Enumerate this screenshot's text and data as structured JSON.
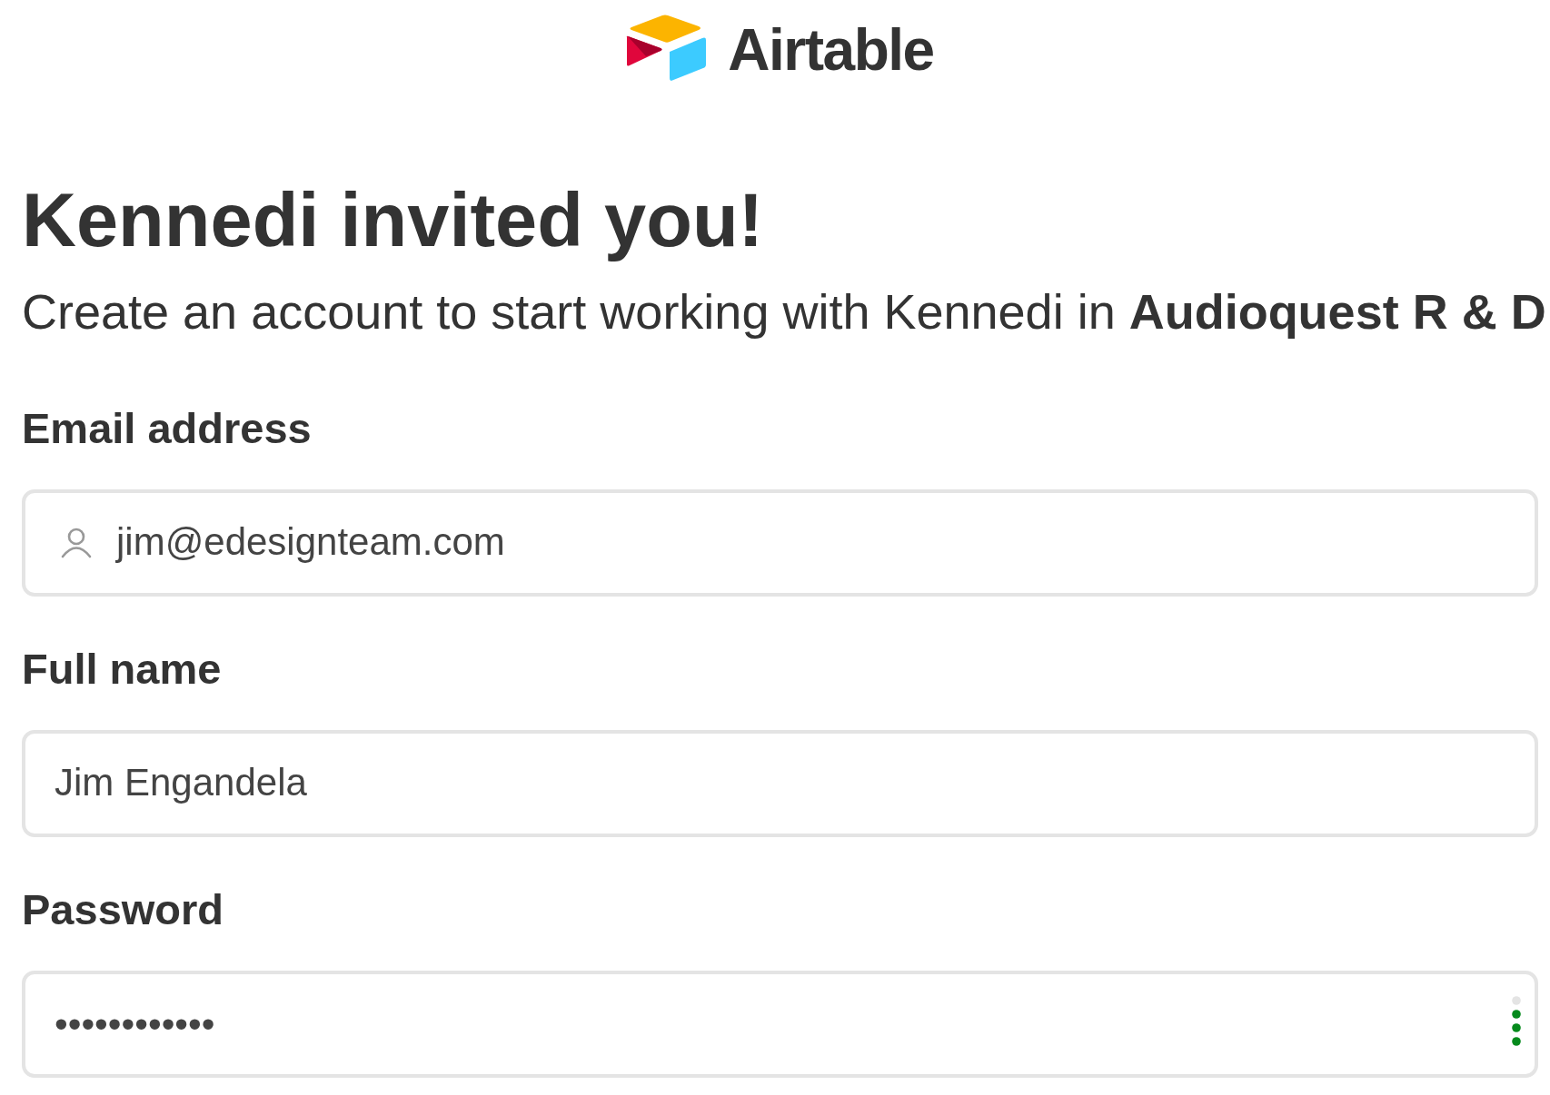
{
  "logo": {
    "wordmark": "Airtable"
  },
  "heading": "Kennedi invited you!",
  "subtitle": "Create an account to start working with Kennedi in **Audioquest R & D**",
  "form": {
    "fields": [
      {
        "kind": "email",
        "label": "Email address",
        "value": "jim@edesignteam.com"
      },
      {
        "kind": "text",
        "label": "Full name",
        "value": "Jim Engandela"
      },
      {
        "kind": "password",
        "label": "Password",
        "value": "••••••••••••",
        "strength": {
          "level": 0.75
        }
      }
    ]
  }
}
